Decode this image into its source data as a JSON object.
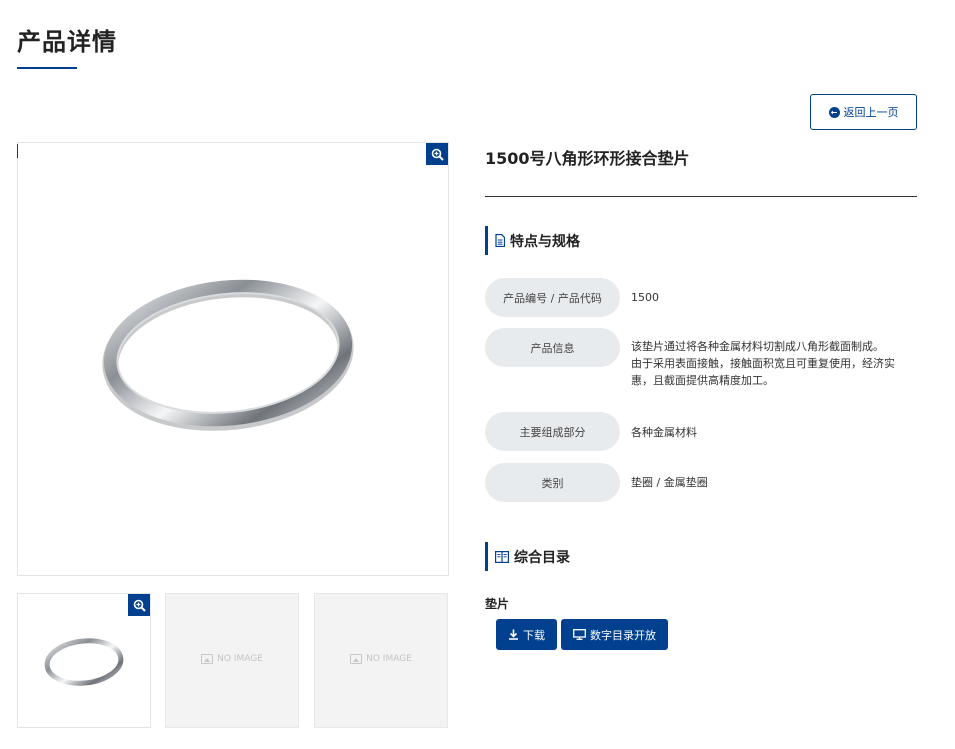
{
  "page": {
    "title": "产品详情"
  },
  "back_button": {
    "label": "返回上一页",
    "icon": "arrow-circle-left-icon"
  },
  "gallery": {
    "main_zoom_icon": "zoom-in-icon",
    "thumbnails": [
      {
        "kind": "image"
      },
      {
        "kind": "placeholder",
        "text": "NO IMAGE"
      },
      {
        "kind": "placeholder",
        "text": "NO IMAGE"
      }
    ]
  },
  "product": {
    "name": "1500号八角形环形接合垫片"
  },
  "specs_section": {
    "title": "特点与规格",
    "icon": "document-icon",
    "rows": [
      {
        "label": "产品编号 / 产品代码",
        "value": "1500"
      },
      {
        "label": "产品信息",
        "value_lines": [
          "该垫片通过将各种金属材料切割成八角形截面制成。",
          "由于采用表面接触，接触面积宽且可重复使用，经济实",
          "惠，且截面提供高精度加工。"
        ]
      },
      {
        "label": "主要组成部分",
        "value": "各种金属材料"
      },
      {
        "label": "类别",
        "value": "垫圈 / 金属垫圈"
      }
    ]
  },
  "catalog_section": {
    "title": "综合目录",
    "icon": "book-icon",
    "item_label": "垫片",
    "download_label": "下载",
    "digital_label": "数字目录开放"
  },
  "colors": {
    "primary": "#00408f",
    "label_bg": "#e8ebee"
  }
}
